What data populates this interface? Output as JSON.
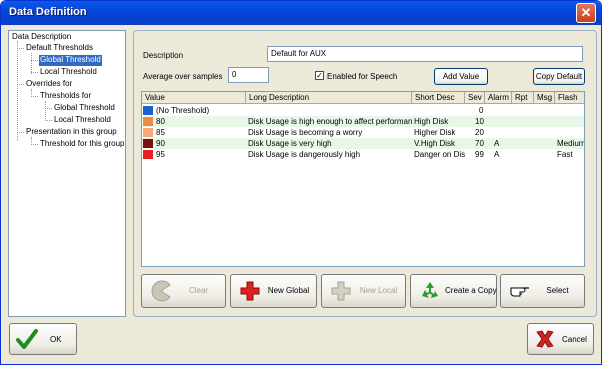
{
  "window": {
    "title": "Data Definition"
  },
  "tree": {
    "items": [
      {
        "label": "Data Description",
        "selected": false
      },
      {
        "label": "Default Thresholds",
        "selected": false
      },
      {
        "label": "Global Threshold",
        "selected": true
      },
      {
        "label": "Local Threshold",
        "selected": false
      },
      {
        "label": "Overrides for",
        "selected": false
      },
      {
        "label": "Thresholds for",
        "selected": false
      },
      {
        "label": "Global Threshold",
        "selected": false
      },
      {
        "label": "Local Threshold",
        "selected": false
      },
      {
        "label": "Presentation in this group",
        "selected": false
      },
      {
        "label": "Threshold for this group",
        "selected": false
      }
    ]
  },
  "form": {
    "description_label": "Description",
    "description_value": "Default for AUX",
    "average_label": "Average over samples",
    "average_value": "0",
    "speech_label": "Enabled for Speech",
    "speech_checked": "✓",
    "add_value_label": "Add Value",
    "copy_default_label": "Copy Default"
  },
  "grid": {
    "columns": [
      "Value",
      "Long Description",
      "Short Desc",
      "Sev",
      "Alarm",
      "Rpt",
      "Msg",
      "Flash"
    ],
    "rows": [
      {
        "color": "#1e5fd0",
        "bg": "#ffffff",
        "value": "(No Threshold)",
        "long": "",
        "short": "",
        "sev": "0",
        "alarm": "",
        "rpt": "",
        "msg": "",
        "flash": ""
      },
      {
        "color": "#f08848",
        "bg": "#e8f8e8",
        "value": "80",
        "long": "Disk Usage is high enough to affect performance",
        "short": "High Disk",
        "sev": "10",
        "alarm": "",
        "rpt": "",
        "msg": "",
        "flash": ""
      },
      {
        "color": "#f8a878",
        "bg": "#ffffff",
        "value": "85",
        "long": "Disk Usage is becoming a worry",
        "short": "Higher Disk",
        "sev": "20",
        "alarm": "",
        "rpt": "",
        "msg": "",
        "flash": ""
      },
      {
        "color": "#7a1010",
        "bg": "#e8f8e8",
        "value": "90",
        "long": "Disk Usage is very high",
        "short": "V.High Disk",
        "sev": "70",
        "alarm": "A",
        "rpt": "",
        "msg": "",
        "flash": "Medium"
      },
      {
        "color": "#e82020",
        "bg": "#ffffff",
        "value": "95",
        "long": "Disk Usage is dangerously high",
        "short": "Danger on Disk",
        "sev": "99",
        "alarm": "A",
        "rpt": "",
        "msg": "",
        "flash": "Fast"
      }
    ]
  },
  "actions": {
    "clear": "Clear",
    "new_global": "New Global",
    "new_local": "New Local",
    "create_copy": "Create a Copy",
    "select": "Select"
  },
  "footer": {
    "ok": "OK",
    "cancel": "Cancel"
  }
}
